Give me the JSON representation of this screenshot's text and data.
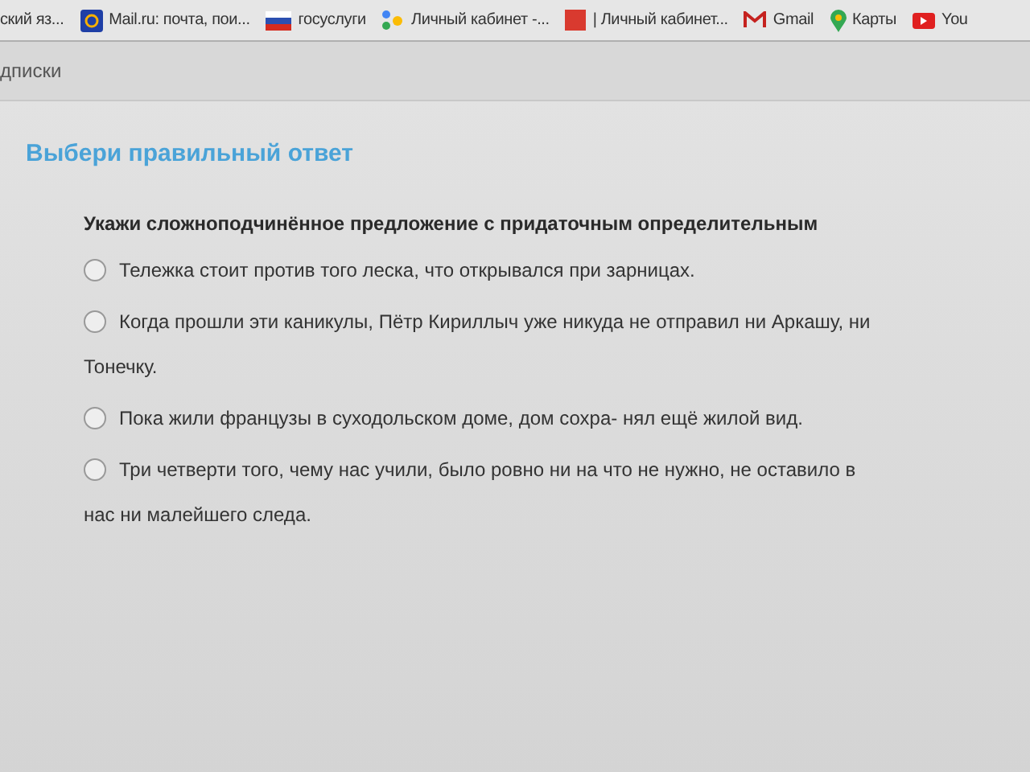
{
  "bookmarks": [
    {
      "label": "ский яз...",
      "kind": "plain"
    },
    {
      "label": "Mail.ru: почта, пои...",
      "kind": "mail"
    },
    {
      "label": "госуслуги",
      "kind": "flag"
    },
    {
      "label": "Личный кабинет -...",
      "kind": "dots"
    },
    {
      "label": "| Личный кабинет...",
      "kind": "square"
    },
    {
      "label": "Gmail",
      "kind": "gmail"
    },
    {
      "label": "Карты",
      "kind": "pin"
    },
    {
      "label": "You",
      "kind": "video"
    }
  ],
  "nav": {
    "label": "дписки"
  },
  "heading": "Выбери правильный ответ",
  "question": "Укажи сложноподчинённое предложение с придаточным определительным",
  "options": [
    {
      "text": "Тележка стоит против того леска, что открывался при зарницах.",
      "selected": false
    },
    {
      "text": "Когда прошли эти каникулы, Пётр Кириллыч уже никуда не отправил ни Аркашу, ни Тонечку.",
      "selected": false
    },
    {
      "text": "Пока жили французы в суходольском доме, дом сохра- нял ещё жилой вид.",
      "selected": false
    },
    {
      "text": "Три четверти того, чему нас учили, было ровно ни на что не нужно, не оставило в нас ни малейшего следа.",
      "selected": false
    }
  ]
}
